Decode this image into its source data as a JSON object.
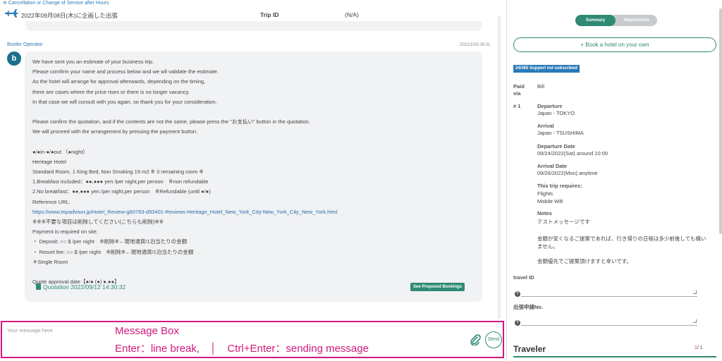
{
  "header": {
    "top_link": "※ Cancellation or Change of Service after Hours",
    "trip_date": "2022年09月08日(木)に企画した出張",
    "trip_id_label": "Trip ID",
    "trip_id_value": "(N/A)"
  },
  "message": {
    "sender": "Border Operator",
    "timestamp": "2022/10/5 08:31",
    "avatar_letter": "b",
    "lines": [
      "We have sent you an estimate of your business trip.",
      "Please comfirm your name and process below and we wll validate the estimate.",
      "As the hotel will arrange for approval afterwards, depending on the timing,",
      "there are cases where the price rises or there is no longer vacancy.",
      "In that case we will consult with you again, so thank you for your consideration.",
      "",
      "Please confirm the quotation, and if the contents are not the same, please press the \"お支払い\" button in the quotation.",
      "We will proceed with the arrangement by pressing the payment button.",
      "",
      "●/●in-●/●out （●night）",
      "Heritage Hotel",
      "Standard Room, 1 King Bed, Non Smoking 19 m2 ※ 3 remaining room ※",
      "1.Breakfast included：●●,●●● yen /per night,per person　※non refundable",
      "2.No breakfast：●●,●●● yen /per night,per person　※Refundable (until ●/●)",
      "Reference URL:",
      "https://www.tripadvisor.jp/Hotel_Review-g60763-d93401-Reviews-Heritage_Hotel_New_York_City-New_York_City_New_York.html",
      "※※※不要な項目は削除してください(こちらも削除)※※",
      "Payment is required on site.",
      "・ Deposit: ○○ $ /per night　※削除※←現地通貨/1泊当たりの金額",
      "・ Resort fee: ○○ $ /per night　※削除※←現地通貨/1泊当たりの金額",
      "＊Single Room",
      "",
      "Quote approval date【●/● (●) ●.●●】"
    ],
    "quotation_link": "Quotation 2022/09/12 14:30:32",
    "proposed_button": "See Proposed Bookings"
  },
  "composer": {
    "placeholder": "Your message here",
    "hint_title": "Message Box",
    "hint_keys": "Enter：line break,　│　Ctrl+Enter：sending message",
    "send_label": "Send"
  },
  "sidebar": {
    "tabs": {
      "summary": "Summary",
      "attachments": "Attachments"
    },
    "book_hotel": "+ Book a hotel on your own",
    "support_badge": "24/365 Support not subscribed",
    "paid_via_label": "Paid via",
    "paid_via_value": "Bill",
    "leg_number": "# 1",
    "departure_label": "Departure",
    "departure_value": "Japan - TOKYO",
    "arrival_label": "Arrival",
    "arrival_value": "Japan - TSUSHIMA",
    "departure_date_label": "Departure Date",
    "departure_date_value": "09/24/2022(Sat) around 10:00",
    "arrival_date_label": "Arrival Date",
    "arrival_date_value": "09/26/2022(Mon) anytime",
    "requires_label": "This trip requires:",
    "requires_items": [
      "Flights",
      "Mobile Wifi"
    ],
    "notes_label": "Notes",
    "notes_lines": [
      "テストメッセージです",
      "",
      "金額が安くなるご提案であれば、行き帰りの日程は多少前後しても構い",
      "ません。",
      "",
      "金額優先でご提案頂けますと幸いです。"
    ],
    "travel_id_label": "travel ID",
    "application_no_label": "出張申請No.",
    "traveler_title": "Traveler",
    "traveler_current": "1",
    "traveler_total": "/ 1"
  },
  "colors": {
    "accent": "#2e8a73",
    "link": "#2a7ab8",
    "highlight": "#d3197d"
  }
}
